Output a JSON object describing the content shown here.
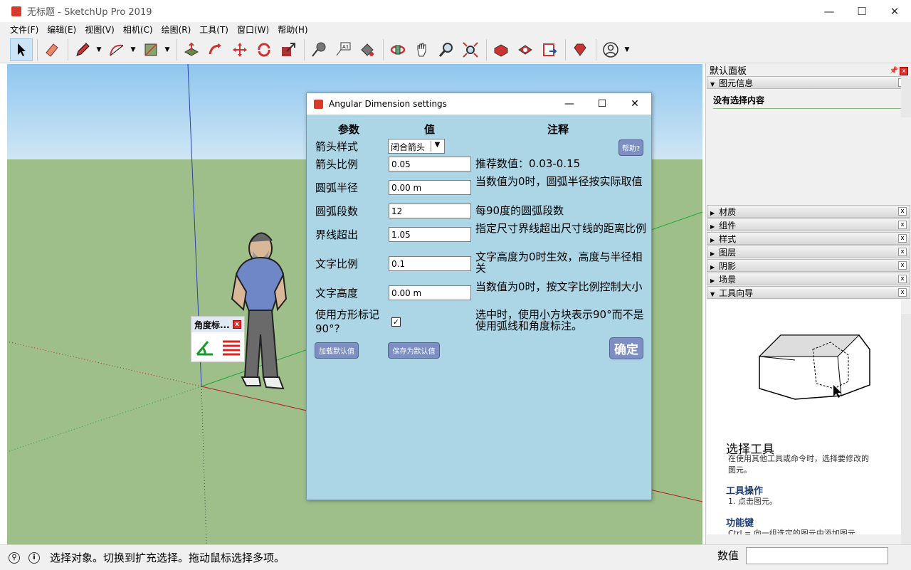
{
  "window": {
    "title": "无标题 - SketchUp Pro 2019",
    "minimize": "—",
    "maximize": "☐",
    "close": "✕"
  },
  "menu": [
    "文件(F)",
    "编辑(E)",
    "视图(V)",
    "相机(C)",
    "绘图(R)",
    "工具(T)",
    "窗口(W)",
    "帮助(H)"
  ],
  "toolbar": {
    "tools": [
      "select-tool",
      "eraser-tool",
      "pencil-tool",
      "arc-tool",
      "rectangle-tool",
      "push-pull-tool",
      "follow-me-tool",
      "move-tool",
      "rotate-tool",
      "scale-tool",
      "tape-measure-tool",
      "text-tool",
      "paint-bucket-tool",
      "orbit-tool",
      "pan-tool",
      "zoom-tool",
      "zoom-extents-tool",
      "warehouse-tool",
      "extension-warehouse-tool",
      "send-to-layout-tool",
      "ruby-tool",
      "account-tool"
    ]
  },
  "dialog": {
    "title": "Angular Dimension settings",
    "min": "—",
    "max": "☐",
    "close": "✕",
    "headers": {
      "param": "参数",
      "value": "值",
      "note": "注释"
    },
    "help_button": "帮助?",
    "arrow_style": {
      "label": "箭头样式",
      "value": "闭合箭头"
    },
    "rows": [
      {
        "label": "箭头比例",
        "value": "0.05",
        "note": "推荐数值：0.03-0.15"
      },
      {
        "label": "圆弧半径",
        "value": "0.00 m",
        "note": "当数值为0时，圆弧半径按实际取值"
      },
      {
        "label": "圆弧段数",
        "value": "12",
        "note": "每90度的圆弧段数"
      },
      {
        "label": "界线超出",
        "value": "1.05",
        "note": "指定尺寸界线超出尺寸线的距离比例"
      },
      {
        "label": "文字比例",
        "value": "0.1",
        "note": "文字高度为0时生效，高度与半径相关"
      },
      {
        "label": "文字高度",
        "value": "0.00 m",
        "note": "当数值为0时，按文字比例控制大小"
      }
    ],
    "square_mark": {
      "label": "使用方形标记90°?",
      "checked": "✓",
      "note": "选中时，使用小方块表示90°而不是使用弧线和角度标注。"
    },
    "load_default": "加载默认值",
    "save_default": "保存为默认值",
    "ok": "确定"
  },
  "mini_toolbar": {
    "title": "角度标...",
    "close": "x"
  },
  "right_panel": {
    "title": "默认面板",
    "entity_info": {
      "title": "图元信息",
      "content": "没有选择内容"
    },
    "sections": [
      "材质",
      "组件",
      "样式",
      "图层",
      "阴影",
      "场景"
    ],
    "instructor": {
      "title": "工具向导",
      "tool_name": "选择工具",
      "tool_desc": "在使用其他工具或命令时，选择要修改的图元。",
      "operation_title": "工具操作",
      "operation_step": "1. 点击图元。",
      "modifier_title": "功能键",
      "modifier_text": "Ctrl = 向一组选定的图元中添加图元"
    }
  },
  "status": {
    "text": "选择对象。切换到扩充选择。拖动鼠标选择多项。",
    "measure_label": "数值",
    "measure_value": ""
  }
}
